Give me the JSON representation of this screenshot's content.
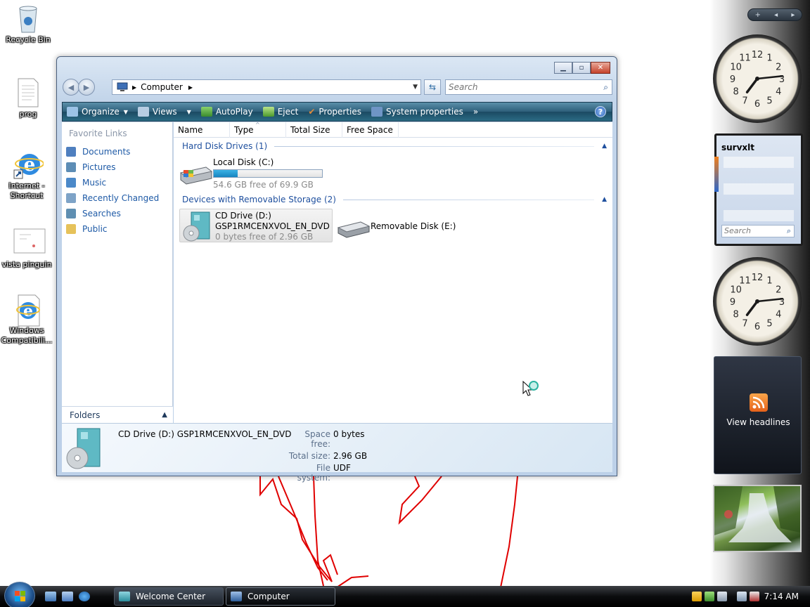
{
  "desktop": {
    "icons": [
      {
        "label": "Recycle Bin"
      },
      {
        "label": "prog"
      },
      {
        "label": "Internet -\nShortcut"
      },
      {
        "label": "vista pinguin"
      },
      {
        "label": "Windows\nCompatibili..."
      }
    ]
  },
  "window": {
    "address": {
      "location": "Computer",
      "dropdown_icon": "chevron-down-icon"
    },
    "search": {
      "placeholder": "Search"
    },
    "toolbar": {
      "organize": "Organize",
      "views": "Views",
      "autoplay": "AutoPlay",
      "eject": "Eject",
      "properties": "Properties",
      "system_properties": "System properties",
      "more": "»",
      "help": "?"
    },
    "nav": {
      "header": "Favorite Links",
      "items": [
        {
          "label": "Documents",
          "color": "#4f7fbf"
        },
        {
          "label": "Pictures",
          "color": "#5d8db5"
        },
        {
          "label": "Music",
          "color": "#4b89c9"
        },
        {
          "label": "Recently Changed",
          "color": "#7ea3c7"
        },
        {
          "label": "Searches",
          "color": "#5f8fb2"
        },
        {
          "label": "Public",
          "color": "#e6c25a"
        }
      ],
      "folders_label": "Folders"
    },
    "columns": [
      "Name",
      "Type",
      "Total Size",
      "Free Space"
    ],
    "groups": {
      "hdd": {
        "title": "Hard Disk Drives (1)",
        "drives": [
          {
            "name": "Local Disk (C:)",
            "free_text": "54.6 GB free of 69.9 GB",
            "used_fraction": 0.22
          }
        ]
      },
      "removable": {
        "title": "Devices with Removable Storage (2)",
        "drives": [
          {
            "name": "CD Drive (D:)",
            "label": "GSP1RMCENXVOL_EN_DVD",
            "free_text": "0 bytes free of 2.96 GB"
          },
          {
            "name": "Removable Disk (E:)"
          }
        ]
      }
    },
    "details": {
      "title": "CD Drive (D:) GSP1RMCENXVOL_EN_DVD",
      "space_free_label": "Space free:",
      "space_free": "0 bytes",
      "total_size_label": "Total size:",
      "total_size": "2.96 GB",
      "file_system_label": "File system:",
      "file_system": "UDF"
    }
  },
  "sidebar": {
    "controls": {
      "add": "+",
      "prev": "◂",
      "next": "▸"
    },
    "clocks": [
      {
        "hour": 7,
        "minute": 14
      },
      {
        "hour": 7,
        "minute": 14
      }
    ],
    "notes": {
      "title": "survxlt",
      "search_placeholder": "Search"
    },
    "feed": {
      "label": "View headlines"
    }
  },
  "taskbar": {
    "buttons": [
      {
        "label": "Welcome Center"
      },
      {
        "label": "Computer"
      }
    ],
    "time": "7:14 AM"
  }
}
